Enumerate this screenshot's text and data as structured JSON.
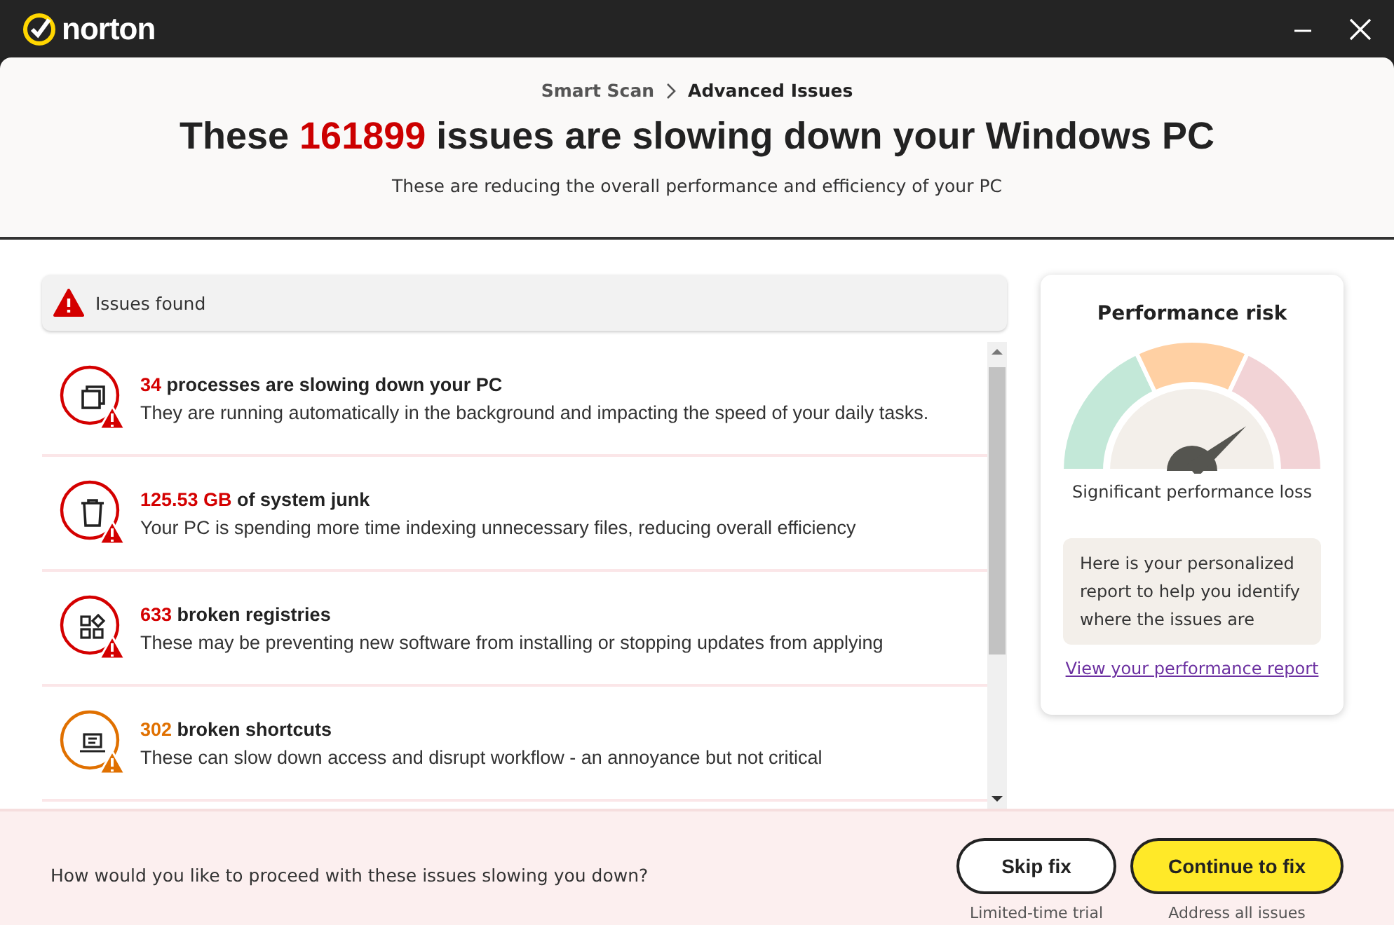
{
  "app": {
    "brand": "norton"
  },
  "breadcrumb": [
    "Smart Scan",
    "Advanced Issues"
  ],
  "headline": {
    "before": "These ",
    "count": "161899",
    "after": " issues are slowing down your Windows PC"
  },
  "subtitle": "These are reducing the overall performance and efficiency of your PC",
  "issues_header": "Issues found",
  "issues": [
    {
      "count": "34",
      "title": "processes are slowing down your PC",
      "description": "They are running automatically in the background and impacting the speed of your daily tasks.",
      "color": "#d40000"
    },
    {
      "count": "125.53 GB",
      "title": "of system junk",
      "description": "Your PC is spending more time indexing unnecessary files, reducing overall efficiency",
      "color": "#d40000"
    },
    {
      "count": "633",
      "title": "broken registries",
      "description": "These may be preventing new software from installing or stopping updates from applying",
      "color": "#d40000"
    },
    {
      "count": "302",
      "title": "broken shortcuts",
      "description": "These can slow down access and disrupt workflow - an annoyance but not critical",
      "color": "#e07000"
    }
  ],
  "risk": {
    "title": "Performance risk",
    "status": "Significant performance loss",
    "note": "Here is your personalized report to help you identify where the issues are",
    "link": "View your performance report"
  },
  "footer": {
    "question": "How would you like to proceed with these issues slowing you down?",
    "actions": [
      {
        "kind": "secondary",
        "label": "Skip fix",
        "caption": "Limited-time trial"
      },
      {
        "kind": "primary",
        "label": "Continue to fix",
        "caption": "Address all issues"
      }
    ]
  }
}
